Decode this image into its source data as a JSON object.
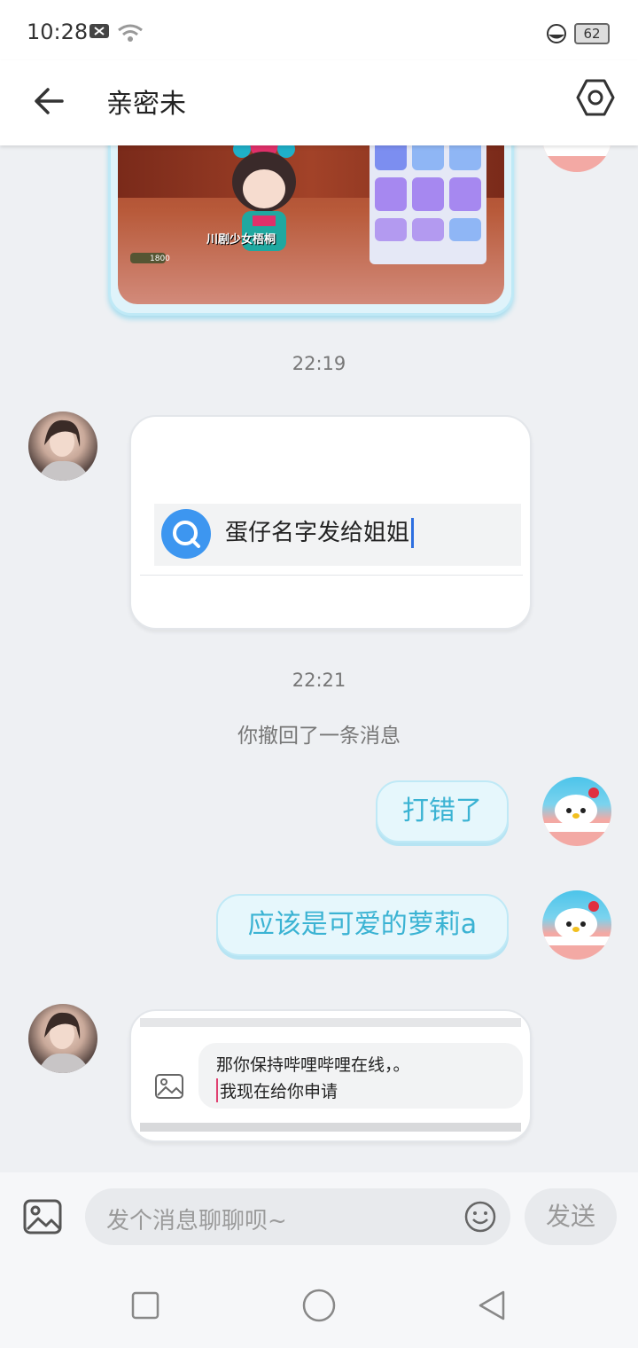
{
  "status_bar": {
    "time": "10:28",
    "battery": "62"
  },
  "header": {
    "title": "亲密未",
    "back_icon": "arrow-left-icon",
    "settings_icon": "hexagon-settings-icon"
  },
  "chat": {
    "game_card": {
      "caption": "川剧少女梧桐",
      "price": "1800"
    },
    "ts1": "22:19",
    "search_card": {
      "text": "蛋仔名字发给姐姐"
    },
    "ts2": "22:21",
    "recalled": "你撤回了一条消息",
    "msg1": "打错了",
    "msg2": "应该是可爱的萝莉a",
    "image_card": {
      "line1": "那你保持哔哩哔哩在线，。",
      "line2": "我现在给你申请"
    }
  },
  "input_bar": {
    "placeholder": "发个消息聊聊呗~",
    "send_label": "发送"
  },
  "colors": {
    "accent": "#3bb3d3",
    "bubble_bg": "#e6f7fc"
  }
}
